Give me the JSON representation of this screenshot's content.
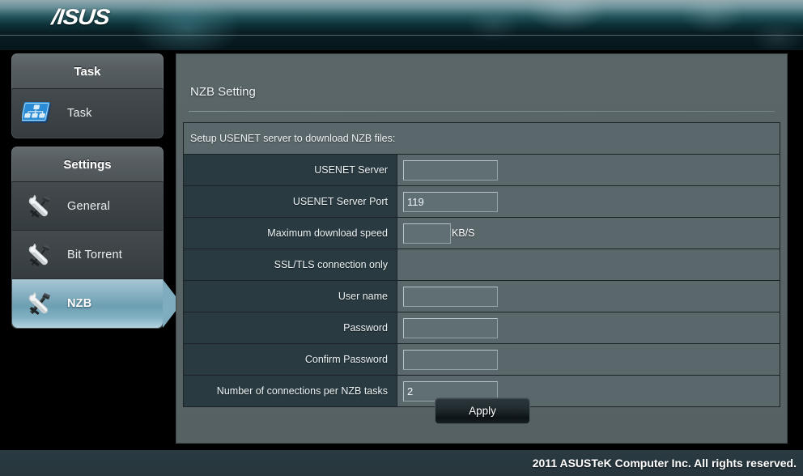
{
  "header": {
    "logo_text": "/ISUS",
    "logo_name": "asus-logo"
  },
  "sidebar": {
    "panels": [
      {
        "title": "Task",
        "items": [
          {
            "label": "Task",
            "icon": "network-task-icon",
            "selected": false
          }
        ]
      },
      {
        "title": "Settings",
        "items": [
          {
            "label": "General",
            "icon": "tools-icon",
            "selected": false
          },
          {
            "label": "Bit Torrent",
            "icon": "tools-icon",
            "selected": false
          },
          {
            "label": "NZB",
            "icon": "tools-icon",
            "selected": true
          }
        ]
      }
    ]
  },
  "main": {
    "page_title": "NZB Setting",
    "section_header": "Setup USENET server to download NZB files:",
    "rows": [
      {
        "label": "USENET Server",
        "value": "",
        "input": "wide",
        "unit": ""
      },
      {
        "label": "USENET Server Port",
        "value": "119",
        "input": "wide",
        "unit": ""
      },
      {
        "label": "Maximum download speed",
        "value": "",
        "input": "small",
        "unit": "KB/S"
      },
      {
        "label": "SSL/TLS connection only",
        "value": "",
        "input": "none",
        "unit": ""
      },
      {
        "label": "User name",
        "value": "",
        "input": "wide",
        "unit": ""
      },
      {
        "label": "Password",
        "value": "",
        "input": "wide",
        "unit": ""
      },
      {
        "label": "Confirm Password",
        "value": "",
        "input": "wide",
        "unit": ""
      },
      {
        "label": "Number of connections per NZB tasks",
        "value": "2",
        "input": "wide",
        "unit": ""
      }
    ],
    "apply_label": "Apply"
  },
  "footer": {
    "copyright": "2011 ASUSTeK Computer Inc. All rights reserved."
  },
  "colors": {
    "accent_selected": "#7fb0c2",
    "label_column": "#293a40",
    "value_column": "#5a676b",
    "panel_bg": "#5b6669"
  }
}
